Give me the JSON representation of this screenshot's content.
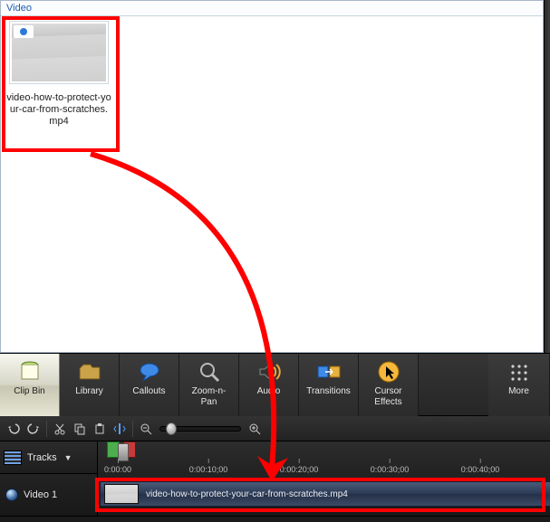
{
  "clipbin": {
    "header": "Video",
    "item": {
      "filename": "video-how-to-protect-your-car-from-scratches.mp4"
    }
  },
  "toolbar": {
    "clip_bin": "Clip Bin",
    "library": "Library",
    "callouts": "Callouts",
    "zoom_n_pan": "Zoom-n-\nPan",
    "audio": "Audio",
    "transitions": "Transitions",
    "cursor_effects": "Cursor\nEffects",
    "more": "More"
  },
  "timeline": {
    "tracks_label": "Tracks",
    "ruler": {
      "t0": "0:00:00",
      "t1": "0:00:10;00",
      "t2": "0:00:20;00",
      "t3": "0:00:30;00",
      "t4": "0:00:40;00"
    },
    "track1_name": "Video 1",
    "clip_filename": "video-how-to-protect-your-car-from-scratches.mp4",
    "clip_filename_trunc": "video-how-to-protect-yo"
  },
  "colors": {
    "annotation": "#ff0000"
  }
}
